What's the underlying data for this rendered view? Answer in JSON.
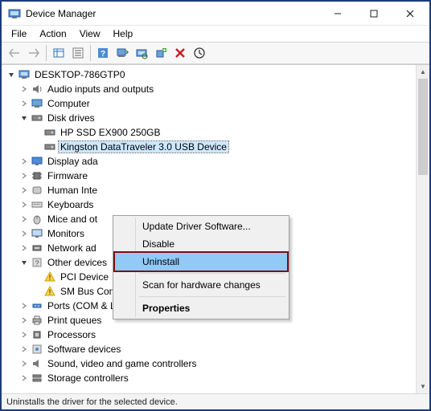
{
  "window": {
    "title": "Device Manager"
  },
  "menubar": [
    "File",
    "Action",
    "View",
    "Help"
  ],
  "toolbar_icons": [
    "back",
    "forward",
    "show-hidden",
    "properties",
    "help",
    "update",
    "scan",
    "add-legacy",
    "uninstall",
    "scan-hardware"
  ],
  "tree": {
    "root": "DESKTOP-786GTP0",
    "categories": [
      {
        "name": "Audio inputs and outputs",
        "expanded": false,
        "icon": "audio"
      },
      {
        "name": "Computer",
        "expanded": false,
        "icon": "computer"
      },
      {
        "name": "Disk drives",
        "expanded": true,
        "icon": "disk",
        "children": [
          {
            "name": "HP SSD EX900 250GB",
            "icon": "disk"
          },
          {
            "name": "Kingston DataTraveler 3.0 USB Device",
            "icon": "disk",
            "selected": true
          }
        ]
      },
      {
        "name": "Display ada",
        "expanded": false,
        "icon": "display",
        "truncated": true
      },
      {
        "name": "Firmware",
        "expanded": false,
        "icon": "firmware"
      },
      {
        "name": "Human Inte",
        "expanded": false,
        "icon": "hid",
        "truncated": true
      },
      {
        "name": "Keyboards",
        "expanded": false,
        "icon": "keyboard"
      },
      {
        "name": "Mice and ot",
        "expanded": false,
        "icon": "mouse",
        "truncated": true
      },
      {
        "name": "Monitors",
        "expanded": false,
        "icon": "monitor"
      },
      {
        "name": "Network ad",
        "expanded": false,
        "icon": "network",
        "truncated": true
      },
      {
        "name": "Other devices",
        "expanded": true,
        "icon": "other",
        "children": [
          {
            "name": "PCI Device",
            "icon": "warning"
          },
          {
            "name": "SM Bus Controller",
            "icon": "warning"
          }
        ]
      },
      {
        "name": "Ports (COM & LPT)",
        "expanded": false,
        "icon": "ports"
      },
      {
        "name": "Print queues",
        "expanded": false,
        "icon": "printer"
      },
      {
        "name": "Processors",
        "expanded": false,
        "icon": "cpu"
      },
      {
        "name": "Software devices",
        "expanded": false,
        "icon": "software"
      },
      {
        "name": "Sound, video and game controllers",
        "expanded": false,
        "icon": "sound"
      },
      {
        "name": "Storage controllers",
        "expanded": false,
        "icon": "storage"
      }
    ]
  },
  "context_menu": {
    "items": [
      {
        "label": "Update Driver Software...",
        "type": "item"
      },
      {
        "label": "Disable",
        "type": "item"
      },
      {
        "label": "Uninstall",
        "type": "item",
        "highlighted": true
      },
      {
        "type": "sep"
      },
      {
        "label": "Scan for hardware changes",
        "type": "item"
      },
      {
        "type": "sep"
      },
      {
        "label": "Properties",
        "type": "item",
        "bold": true
      }
    ]
  },
  "statusbar": "Uninstalls the driver for the selected device."
}
